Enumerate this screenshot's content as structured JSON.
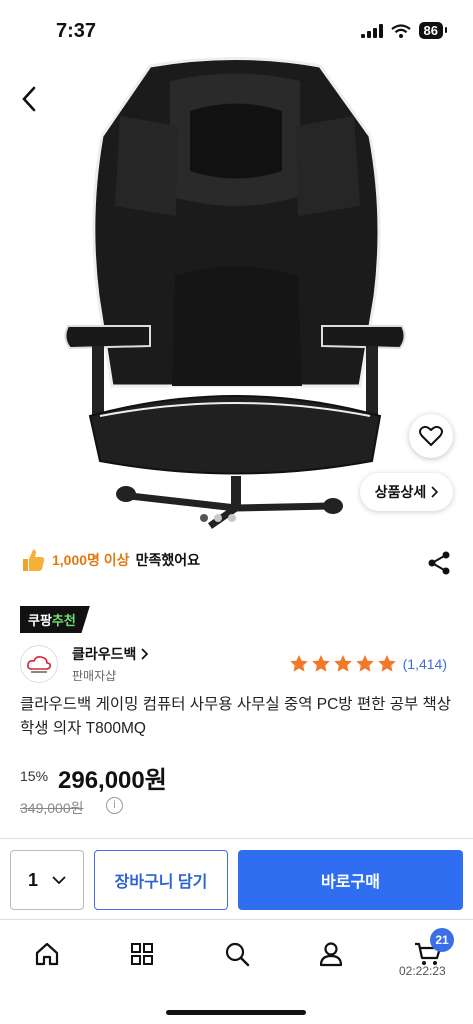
{
  "status": {
    "time": "7:37",
    "battery": "86"
  },
  "hero": {
    "detail_label": "상품상세",
    "dots_count": 3
  },
  "satisfaction": {
    "count": "1,000명 이상",
    "text": "만족했어요"
  },
  "badge": {
    "main": "쿠팡",
    "accent": "추천"
  },
  "seller": {
    "name": "클라우드백",
    "sub": "판매자샵",
    "logo_text": "CloudBack"
  },
  "rating": {
    "stars": 5,
    "count": "(1,414)"
  },
  "product": {
    "title": "클라우드백 게이밍 컴퓨터 사무용 사무실 중역 PC방 편한 공부 책상 학생 의자 T800MQ",
    "discount": "15%",
    "price": "296,000원",
    "original_price": "349,000원"
  },
  "actions": {
    "quantity": "1",
    "cart_label": "장바구니 담기",
    "buy_label": "바로구매"
  },
  "tabbar": {
    "cart_count": "21",
    "clock": "02:22:23"
  },
  "colors": {
    "accent_blue": "#2f6ef0",
    "star": "#f07a2a",
    "satisfaction": "#e07b10"
  }
}
